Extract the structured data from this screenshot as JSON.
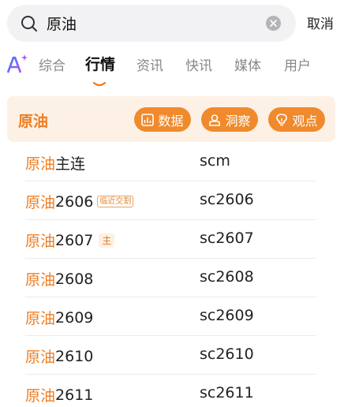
{
  "search": {
    "query": "原油",
    "cancel_label": "取消"
  },
  "tabs": {
    "items": [
      {
        "label": "综合"
      },
      {
        "label": "行情"
      },
      {
        "label": "资讯"
      },
      {
        "label": "快讯"
      },
      {
        "label": "媒体"
      },
      {
        "label": "用户"
      }
    ],
    "active": "行情"
  },
  "header": {
    "title": "原油",
    "buttons": [
      {
        "label": "数据",
        "icon": "chart-icon"
      },
      {
        "label": "洞察",
        "icon": "person-icon"
      },
      {
        "label": "观点",
        "icon": "bulb-icon"
      }
    ]
  },
  "contracts": [
    {
      "name_hl": "原油",
      "name_rest": "主连",
      "tag": "",
      "code": "scm"
    },
    {
      "name_hl": "原油",
      "name_rest": "2606",
      "tag": "临近交割",
      "code": "sc2606"
    },
    {
      "name_hl": "原油",
      "name_rest": "2607",
      "tag": "主",
      "code": "sc2607"
    },
    {
      "name_hl": "原油",
      "name_rest": "2608",
      "tag": "",
      "code": "sc2608"
    },
    {
      "name_hl": "原油",
      "name_rest": "2609",
      "tag": "",
      "code": "sc2609"
    },
    {
      "name_hl": "原油",
      "name_rest": "2610",
      "tag": "",
      "code": "sc2610"
    },
    {
      "name_hl": "原油",
      "name_rest": "2611",
      "tag": "",
      "code": "sc2611"
    }
  ],
  "colors": {
    "accent": "#ee7d22",
    "pill": "#f08a2c",
    "header_bg": "#fdf1e6"
  }
}
